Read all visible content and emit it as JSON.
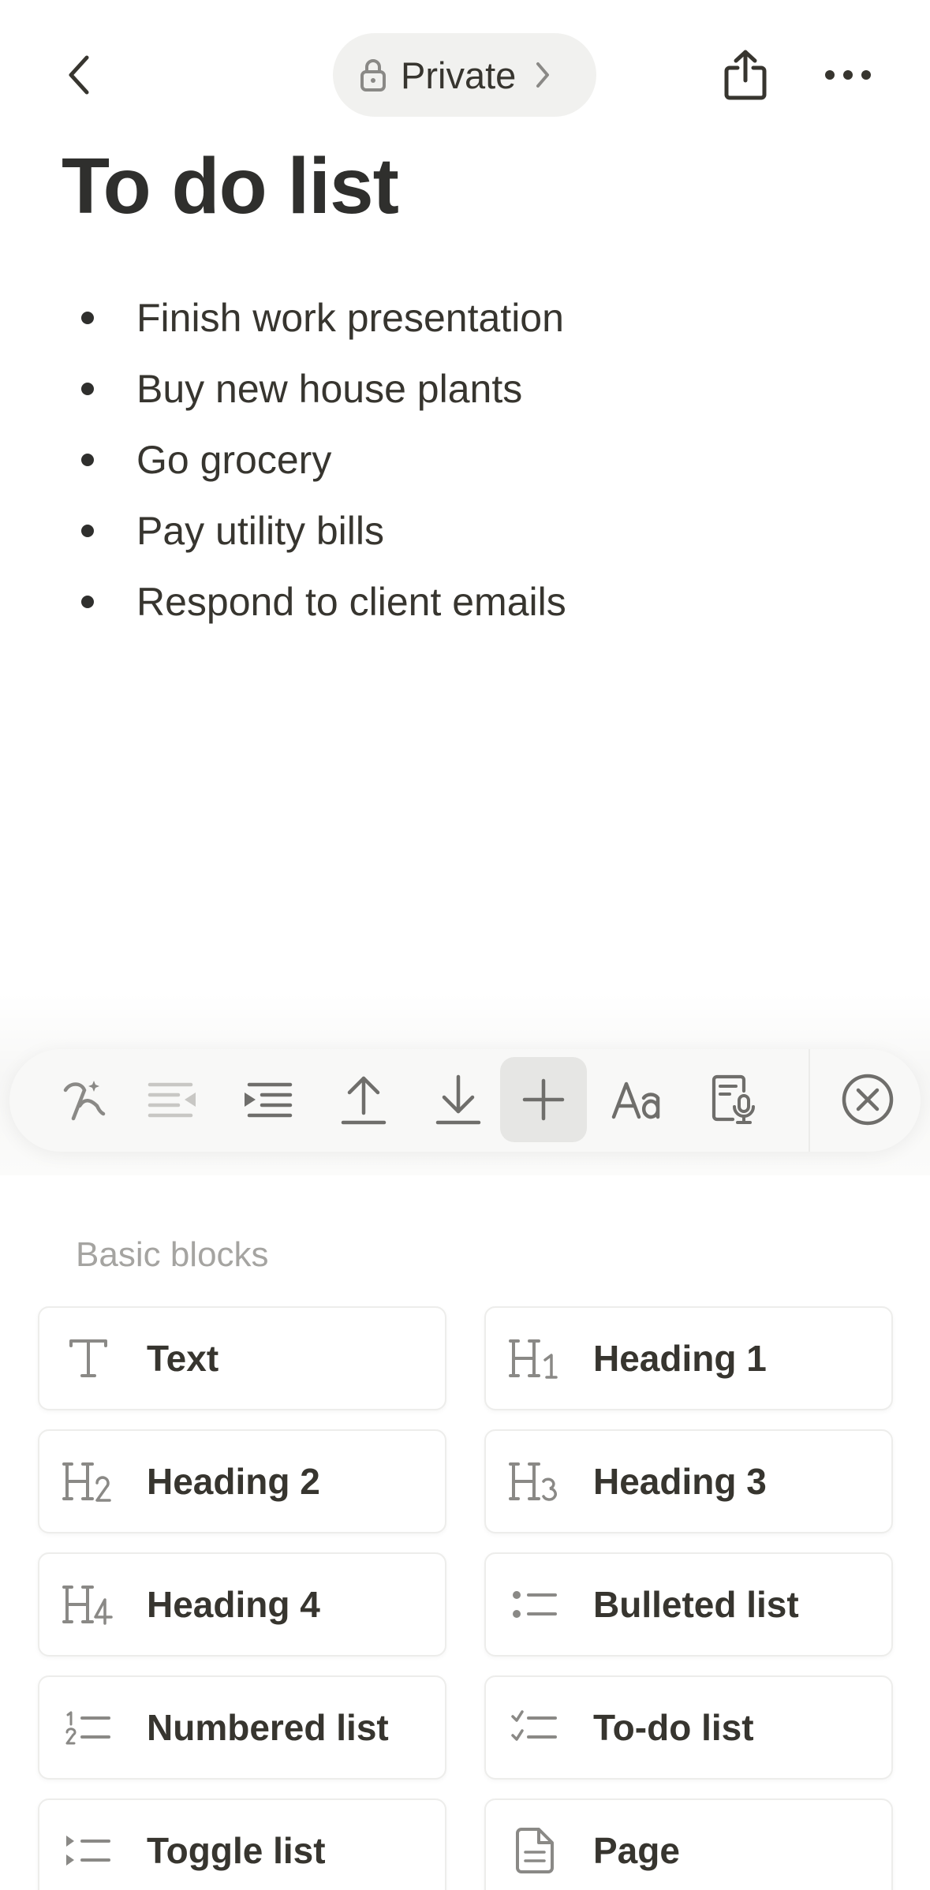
{
  "header": {
    "privacy_label": "Private"
  },
  "page": {
    "title": "To do list",
    "bullets": [
      "Finish work presentation",
      "Buy new house plants",
      "Go grocery",
      "Pay utility bills",
      "Respond to client emails"
    ]
  },
  "toolbar": {
    "tools": [
      "ai-icon",
      "outdent-icon",
      "indent-icon",
      "move-up-icon",
      "move-down-icon",
      "add-block-icon",
      "text-style-icon",
      "transcribe-icon",
      "close-icon"
    ],
    "active_tool": "add-block-icon"
  },
  "blocks": {
    "section_label": "Basic blocks",
    "items": [
      {
        "label": "Text",
        "icon": "text-icon"
      },
      {
        "label": "Heading 1",
        "icon": "heading-1-icon"
      },
      {
        "label": "Heading 2",
        "icon": "heading-2-icon"
      },
      {
        "label": "Heading 3",
        "icon": "heading-3-icon"
      },
      {
        "label": "Heading 4",
        "icon": "heading-4-icon"
      },
      {
        "label": "Bulleted list",
        "icon": "bulleted-list-icon"
      },
      {
        "label": "Numbered list",
        "icon": "numbered-list-icon"
      },
      {
        "label": "To-do list",
        "icon": "todo-list-icon"
      },
      {
        "label": "Toggle list",
        "icon": "toggle-list-icon"
      },
      {
        "label": "Page",
        "icon": "page-icon"
      }
    ]
  },
  "colors": {
    "text": "#37352f",
    "muted": "#a5a4a1",
    "icon": "#8a8986",
    "pill_bg": "#f1f1ef"
  }
}
